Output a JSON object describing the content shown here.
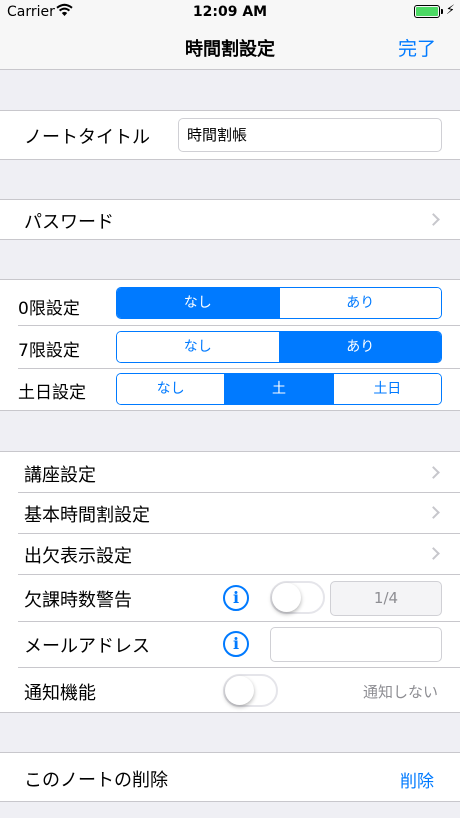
{
  "status": {
    "carrier": "Carrier",
    "time": "12:09 AM"
  },
  "nav": {
    "title": "時間割設定",
    "done": "完了"
  },
  "note_title": {
    "label": "ノートタイトル",
    "value": "時間割帳"
  },
  "password": {
    "label": "パスワード"
  },
  "period0": {
    "label": "0限設定",
    "options": [
      "なし",
      "あり"
    ],
    "selected": "なし"
  },
  "period7": {
    "label": "7限設定",
    "options": [
      "なし",
      "あり"
    ],
    "selected": "あり"
  },
  "weekend": {
    "label": "土日設定",
    "options": [
      "なし",
      "土",
      "土日"
    ],
    "selected": "土"
  },
  "course": {
    "label": "講座設定"
  },
  "basic_timetable": {
    "label": "基本時間割設定"
  },
  "attendance_display": {
    "label": "出欠表示設定"
  },
  "absence_warning": {
    "label": "欠課時数警告",
    "value": "1/4",
    "toggle_on": false
  },
  "email": {
    "label": "メールアドレス",
    "value": ""
  },
  "notification": {
    "label": "通知機能",
    "status": "通知しない",
    "toggle_on": false
  },
  "delete_note": {
    "label": "このノートの削除",
    "action": "削除"
  },
  "colors": {
    "accent": "#007aff",
    "background": "#efeff4",
    "battery": "#4cd964"
  },
  "icons": [
    "wifi-icon",
    "battery-icon",
    "charging-bolt-icon",
    "chevron-right-icon",
    "info-icon"
  ]
}
